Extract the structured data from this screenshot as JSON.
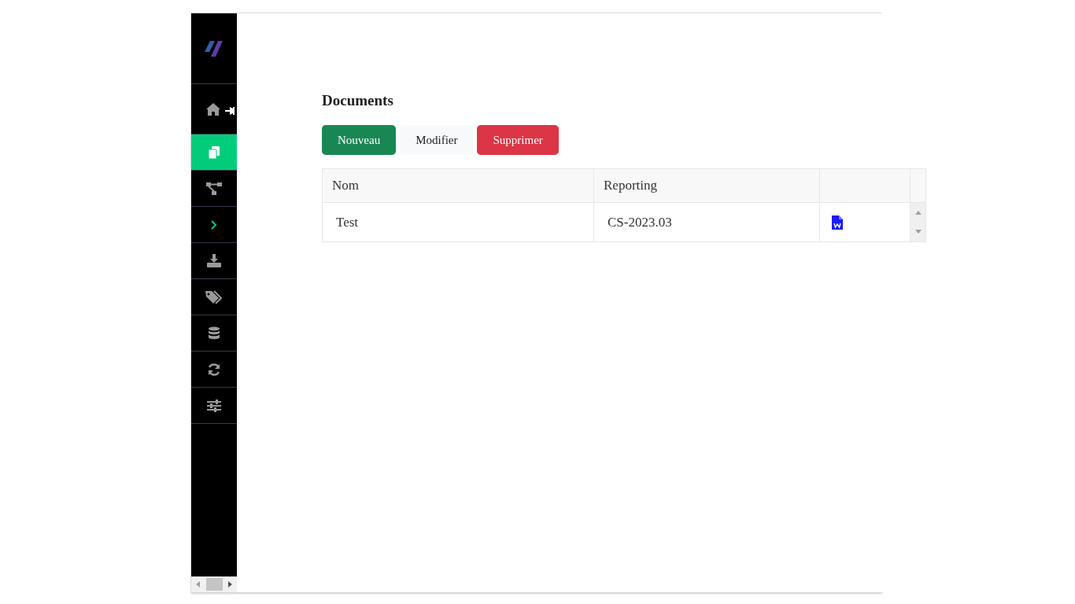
{
  "sidebar": {
    "items": [
      {
        "selected": false
      },
      {
        "selected": true
      },
      {
        "selected": false
      },
      {
        "selected": false
      },
      {
        "selected": false
      },
      {
        "selected": false
      },
      {
        "selected": false
      },
      {
        "selected": false
      },
      {
        "selected": false
      }
    ]
  },
  "page": {
    "title": "Documents"
  },
  "buttons": [
    {
      "label": "Nouveau",
      "kind": "success"
    },
    {
      "label": "Modifier",
      "kind": "light"
    },
    {
      "label": "Supprimer",
      "kind": "danger"
    }
  ],
  "table": {
    "columns": [
      "Nom",
      "Reporting"
    ],
    "rows": [
      {
        "cells": [
          "Test",
          "CS-2023.03"
        ]
      }
    ]
  }
}
